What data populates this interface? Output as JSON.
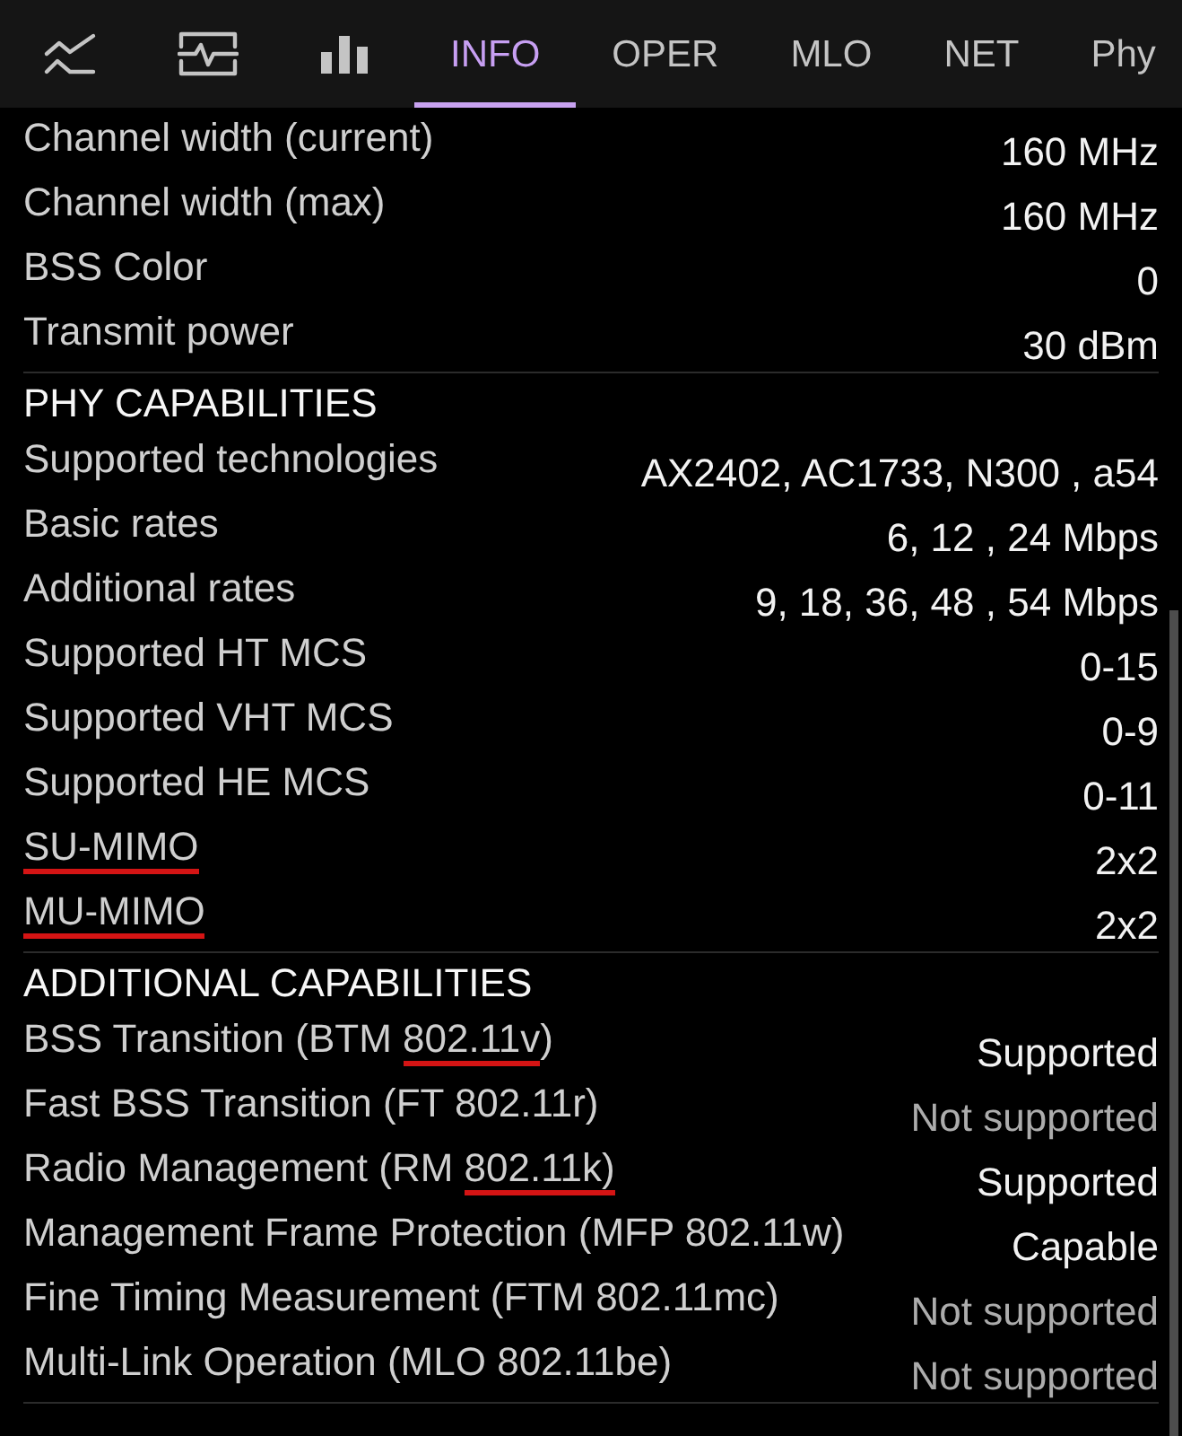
{
  "tabs": [
    {
      "kind": "icon",
      "selected": false
    },
    {
      "kind": "icon",
      "selected": false
    },
    {
      "kind": "icon",
      "selected": false
    },
    {
      "kind": "text",
      "label": "INFO",
      "selected": true
    },
    {
      "kind": "text",
      "label": "OPER",
      "selected": false
    },
    {
      "kind": "text",
      "label": "MLO",
      "selected": false
    },
    {
      "kind": "text",
      "label": "NET",
      "selected": false
    },
    {
      "kind": "text",
      "label": "Phy",
      "selected": false
    }
  ],
  "sections": [
    {
      "rows": [
        {
          "label": "Channel width (current)",
          "value": "160 MHz",
          "dimmed": false
        },
        {
          "label": "Channel width (max)",
          "value": "160 MHz",
          "dimmed": false
        },
        {
          "label": "BSS Color",
          "value": "0",
          "dimmed": false
        },
        {
          "label": "Transmit power",
          "value": "30 dBm",
          "dimmed": false
        }
      ]
    },
    {
      "title": "PHY CAPABILITIES",
      "rows": [
        {
          "label": "Supported technologies",
          "value": "AX2402, AC1733, N300 , a54",
          "dimmed": false
        },
        {
          "label": "Basic rates",
          "value": "6, 12 , 24 Mbps",
          "dimmed": false
        },
        {
          "label": "Additional rates",
          "value": "9, 18, 36, 48 , 54 Mbps",
          "dimmed": false
        },
        {
          "label": "Supported HT MCS",
          "value": "0-15",
          "dimmed": false
        },
        {
          "label": "Supported VHT MCS",
          "value": "0-9",
          "dimmed": false
        },
        {
          "label": "Supported HE MCS",
          "value": "0-11",
          "dimmed": false
        },
        {
          "label_parts": [
            {
              "text": "SU-MIMO",
              "underlined": true
            }
          ],
          "value": "2x2",
          "dimmed": false
        },
        {
          "label_parts": [
            {
              "text": "MU-MIMO",
              "underlined": true
            }
          ],
          "value": "2x2",
          "dimmed": false
        }
      ]
    },
    {
      "title": "ADDITIONAL CAPABILITIES",
      "rows": [
        {
          "label_parts": [
            {
              "text": "BSS Transition (BTM ",
              "underlined": false
            },
            {
              "text": "802.11v",
              "underlined": true
            },
            {
              "text": ")",
              "underlined": false
            }
          ],
          "value": "Supported",
          "dimmed": false
        },
        {
          "label": "Fast BSS Transition (FT 802.11r)",
          "value": "Not supported",
          "dimmed": true
        },
        {
          "label_parts": [
            {
              "text": "Radio Management (RM ",
              "underlined": false
            },
            {
              "text": "802.11k)",
              "underlined": true
            }
          ],
          "value": "Supported",
          "dimmed": false
        },
        {
          "label": "Management Frame Protection (MFP 802.11w)",
          "value": "Capable",
          "dimmed": false
        },
        {
          "label": "Fine Timing Measurement (FTM 802.11mc)",
          "value": "Not supported",
          "dimmed": true
        },
        {
          "label": "Multi-Link Operation (MLO 802.11be)",
          "value": "Not supported",
          "dimmed": true
        }
      ]
    }
  ]
}
